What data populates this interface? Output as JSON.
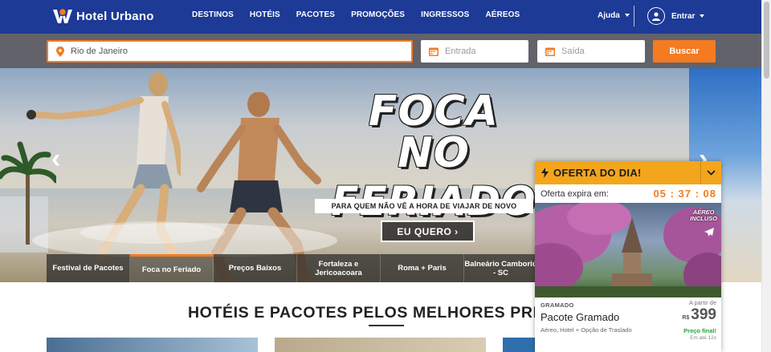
{
  "header": {
    "brand": "Hotel Urbano",
    "nav": [
      "DESTINOS",
      "HOTÉIS",
      "PACOTES",
      "PROMOÇÕES",
      "INGRESSOS",
      "AÉREOS"
    ],
    "help_label": "Ajuda",
    "login_label": "Entrar"
  },
  "search": {
    "destination_value": "Rio de Janeiro",
    "checkin_placeholder": "Entrada",
    "checkout_placeholder": "Saída",
    "search_button": "Buscar"
  },
  "hero": {
    "headline_line1": "FOCA NO",
    "headline_line2": "FERIADO",
    "strapline": "PARA QUEM NÃO VÊ A HORA DE VIAJAR DE NOVO",
    "cta_label": "EU QUERO",
    "cta_arrow": "›",
    "prev_arrow": "‹",
    "next_arrow": "›",
    "tabs": [
      {
        "label": "Festival de Pacotes"
      },
      {
        "label": "Foca no Feriado"
      },
      {
        "label": "Preços Baixos"
      },
      {
        "label": "Fortaleza e Jericoacoara"
      },
      {
        "label": "Roma + Paris"
      },
      {
        "label": "Balneário Camboriú - SC"
      }
    ],
    "active_tab": 1
  },
  "section": {
    "title": "HOTÉIS E PACOTES PELOS MELHORES PRE"
  },
  "offer": {
    "title": "OFERTA DO DIA!",
    "expires_label": "Oferta expira em:",
    "countdown": "05 : 37 : 08",
    "badge_line1": "AÉREO",
    "badge_line2": "INCLUSO",
    "city": "GRAMADO",
    "package_name": "Pacote Gramado",
    "description": "Aéreo, Hotel + Opção de Traslado",
    "from_label": "A partir de",
    "currency": "R$",
    "price": "399",
    "final_label": "Preço final!",
    "installments": "Em até 12x"
  },
  "colors": {
    "nav_blue": "#1c3a96",
    "accent_orange": "#f47b20",
    "offer_yellow": "#f3a61b",
    "price_green": "#2aa23a"
  }
}
